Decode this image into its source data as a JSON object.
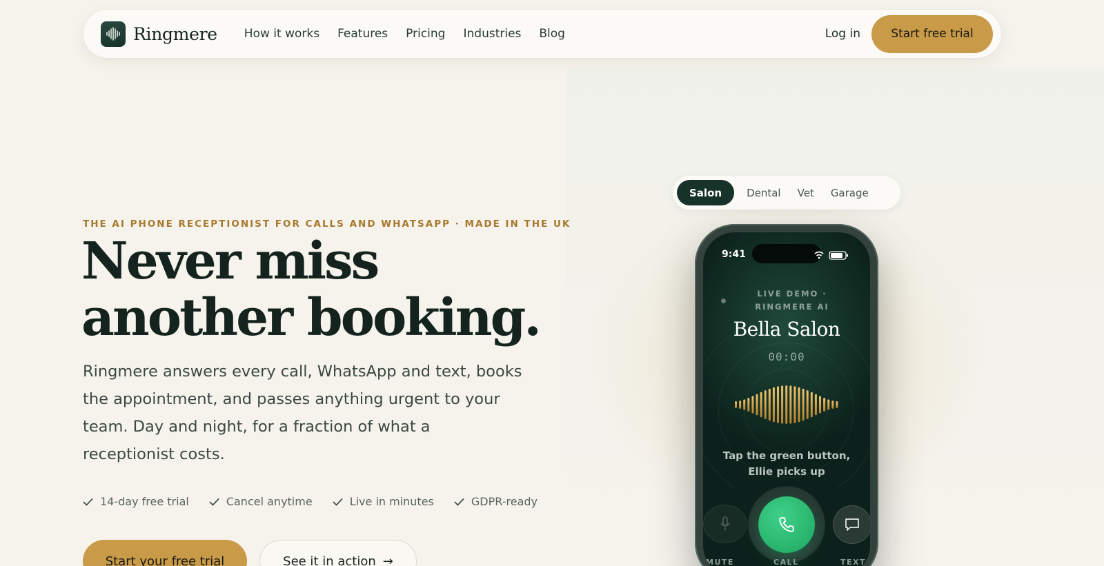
{
  "brand": {
    "name": "Ringmere"
  },
  "nav": {
    "links": [
      "How it works",
      "Features",
      "Pricing",
      "Industries",
      "Blog"
    ],
    "login": "Log in",
    "cta": "Start free trial"
  },
  "hero": {
    "eyebrow": "THE AI PHONE RECEPTIONIST FOR CALLS AND WHATSAPP · MADE IN THE UK",
    "headline_line1": "Never miss",
    "headline_line2": "another booking.",
    "lede": "Ringmere answers every call, WhatsApp and text, books the appointment, and passes anything urgent to your team. Day and night, for a fraction of what a receptionist costs.",
    "checks": [
      "14-day free trial",
      "Cancel anytime",
      "Live in minutes",
      "GDPR-ready"
    ],
    "primary_cta": "Start your free trial",
    "secondary_cta": "See it in action",
    "secondary_arrow": "→"
  },
  "demo": {
    "tabs": [
      "Salon",
      "Dental",
      "Vet",
      "Garage"
    ],
    "active_tab": "Salon",
    "phone": {
      "time": "9:41",
      "live_label": "LIVE DEMO · RINGMERE AI",
      "business": "Bella Salon",
      "timer": "00:00",
      "hint": "Tap the green button, Ellie picks up",
      "buttons": {
        "mute": "MUTE",
        "call": "CALL",
        "text": "TEXT"
      }
    }
  },
  "colors": {
    "accent": "#c99a47",
    "dark_green": "#163229",
    "eyebrow": "#a7782d",
    "call_green": "#2bbd74"
  },
  "icons": [
    "logo-waveform-icon",
    "check-icon",
    "arrow-right-icon",
    "wifi-icon",
    "battery-icon",
    "microphone-icon",
    "phone-icon",
    "message-icon",
    "audio-waveform"
  ]
}
